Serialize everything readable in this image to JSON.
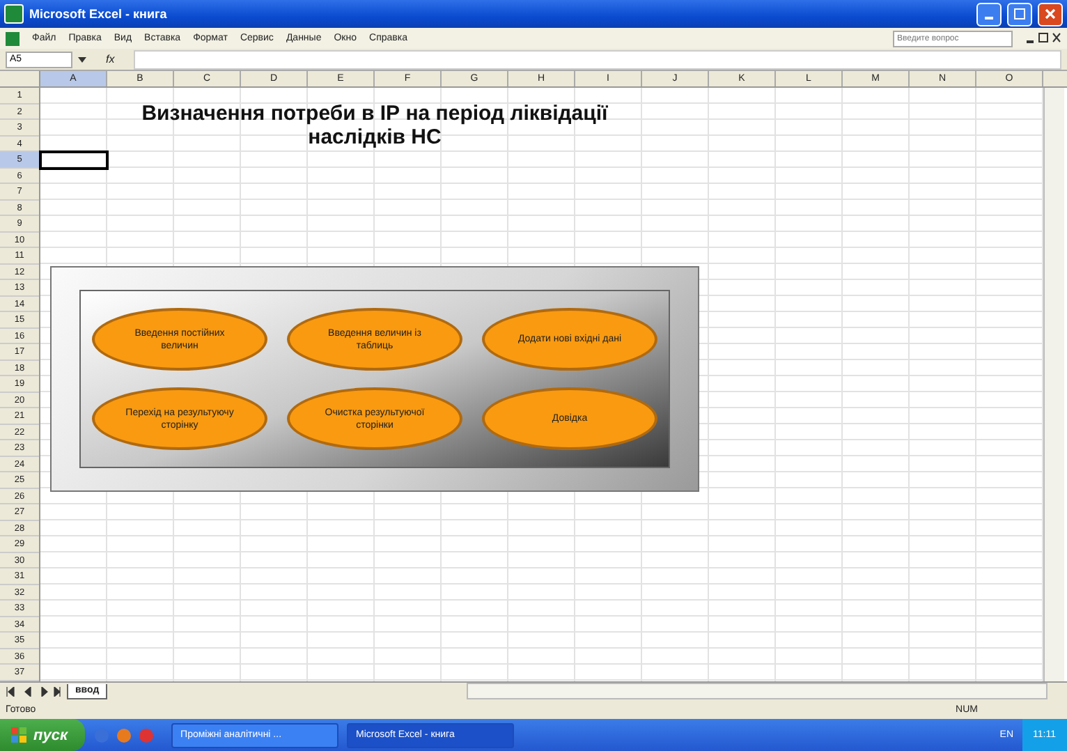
{
  "window": {
    "title": "Microsoft Excel - книга"
  },
  "menu": [
    "Файл",
    "Правка",
    "Вид",
    "Вставка",
    "Формат",
    "Сервис",
    "Данные",
    "Окно",
    "Справка"
  ],
  "help_search": {
    "placeholder": "Введите вопрос"
  },
  "name_box": {
    "value": "A5"
  },
  "formula_bar": {
    "function_label": "fx"
  },
  "columns": [
    {
      "label": "A",
      "selected": true
    },
    {
      "label": "B",
      "selected": false
    },
    {
      "label": "C",
      "selected": false
    },
    {
      "label": "D",
      "selected": false
    },
    {
      "label": "E",
      "selected": false
    },
    {
      "label": "F",
      "selected": false
    },
    {
      "label": "G",
      "selected": false
    },
    {
      "label": "H",
      "selected": false
    },
    {
      "label": "I",
      "selected": false
    },
    {
      "label": "J",
      "selected": false
    },
    {
      "label": "K",
      "selected": false
    },
    {
      "label": "L",
      "selected": false
    },
    {
      "label": "M",
      "selected": false
    },
    {
      "label": "N",
      "selected": false
    },
    {
      "label": "O",
      "selected": false
    }
  ],
  "rows": [
    {
      "label": "1",
      "selected": false
    },
    {
      "label": "2",
      "selected": false
    },
    {
      "label": "3",
      "selected": false
    },
    {
      "label": "4",
      "selected": false
    },
    {
      "label": "5",
      "selected": true
    },
    {
      "label": "6",
      "selected": false
    },
    {
      "label": "7",
      "selected": false
    },
    {
      "label": "8",
      "selected": false
    },
    {
      "label": "9",
      "selected": false
    },
    {
      "label": "10",
      "selected": false
    },
    {
      "label": "11",
      "selected": false
    },
    {
      "label": "12",
      "selected": false
    },
    {
      "label": "13",
      "selected": false
    },
    {
      "label": "14",
      "selected": false
    },
    {
      "label": "15",
      "selected": false
    },
    {
      "label": "16",
      "selected": false
    },
    {
      "label": "17",
      "selected": false
    },
    {
      "label": "18",
      "selected": false
    },
    {
      "label": "19",
      "selected": false
    },
    {
      "label": "20",
      "selected": false
    },
    {
      "label": "21",
      "selected": false
    },
    {
      "label": "22",
      "selected": false
    },
    {
      "label": "23",
      "selected": false
    },
    {
      "label": "24",
      "selected": false
    },
    {
      "label": "25",
      "selected": false
    },
    {
      "label": "26",
      "selected": false
    },
    {
      "label": "27",
      "selected": false
    },
    {
      "label": "28",
      "selected": false
    },
    {
      "label": "29",
      "selected": false
    },
    {
      "label": "30",
      "selected": false
    },
    {
      "label": "31",
      "selected": false
    },
    {
      "label": "32",
      "selected": false
    },
    {
      "label": "33",
      "selected": false
    },
    {
      "label": "34",
      "selected": false
    },
    {
      "label": "35",
      "selected": false
    },
    {
      "label": "36",
      "selected": false
    },
    {
      "label": "37",
      "selected": false
    }
  ],
  "heading": "Визначення потреби в ІР на період ліквідації наслідків  НС",
  "buttons": [
    "Введення постійних величин",
    "Введення величин із таблиць",
    "Додати нові вхідні дані",
    "Перехід на результуючу сторінку",
    "Очистка результуючої сторінки",
    "Довідка"
  ],
  "sheet_tabs": [
    {
      "label": "ввод",
      "selected": true
    }
  ],
  "status_bar": {
    "status": "Готово",
    "num": "NUM"
  },
  "taskbar": {
    "start": "пуск",
    "tasks": [
      {
        "label": "Проміжні аналітичні ...",
        "selected": false
      },
      {
        "label": "Microsoft Excel - книга",
        "selected": true
      }
    ],
    "language": "EN",
    "clock": "11:11"
  }
}
